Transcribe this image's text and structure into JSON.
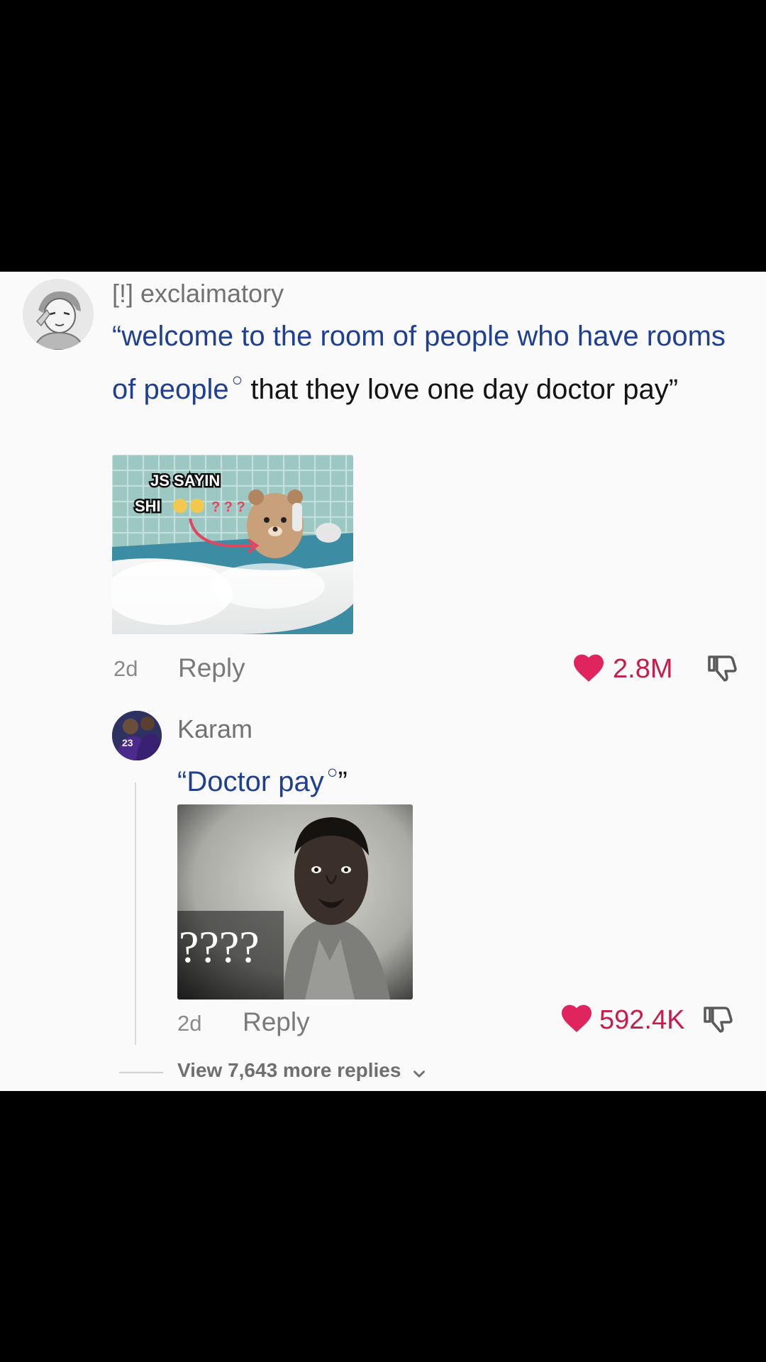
{
  "comment": {
    "username": "[!] exclaimatory",
    "text_link": "“welcome to the room of people who have rooms of people",
    "text_rest": " that they love one day doctor pay”",
    "sticker_text_line1": "JS SAYIN",
    "sticker_text_line2": "SHI",
    "sticker_marks": "? ? ?",
    "age": "2d",
    "reply_label": "Reply",
    "likes": "2.8M"
  },
  "reply": {
    "username": "Karam",
    "avatar_text": "23",
    "text_link": "“Doctor pay",
    "text_rest": "”",
    "sticker_text": "????",
    "age": "2d",
    "reply_label": "Reply",
    "likes": "592.4K"
  },
  "view_more": "View 7,643 more replies",
  "colors": {
    "link": "#1f3f91",
    "like": "#e0245e",
    "background": "#fafafb"
  },
  "icons": {
    "like": "heart-icon",
    "dislike": "thumbs-down-icon",
    "expand": "chevron-down-icon",
    "search_marker": "circle-icon"
  }
}
